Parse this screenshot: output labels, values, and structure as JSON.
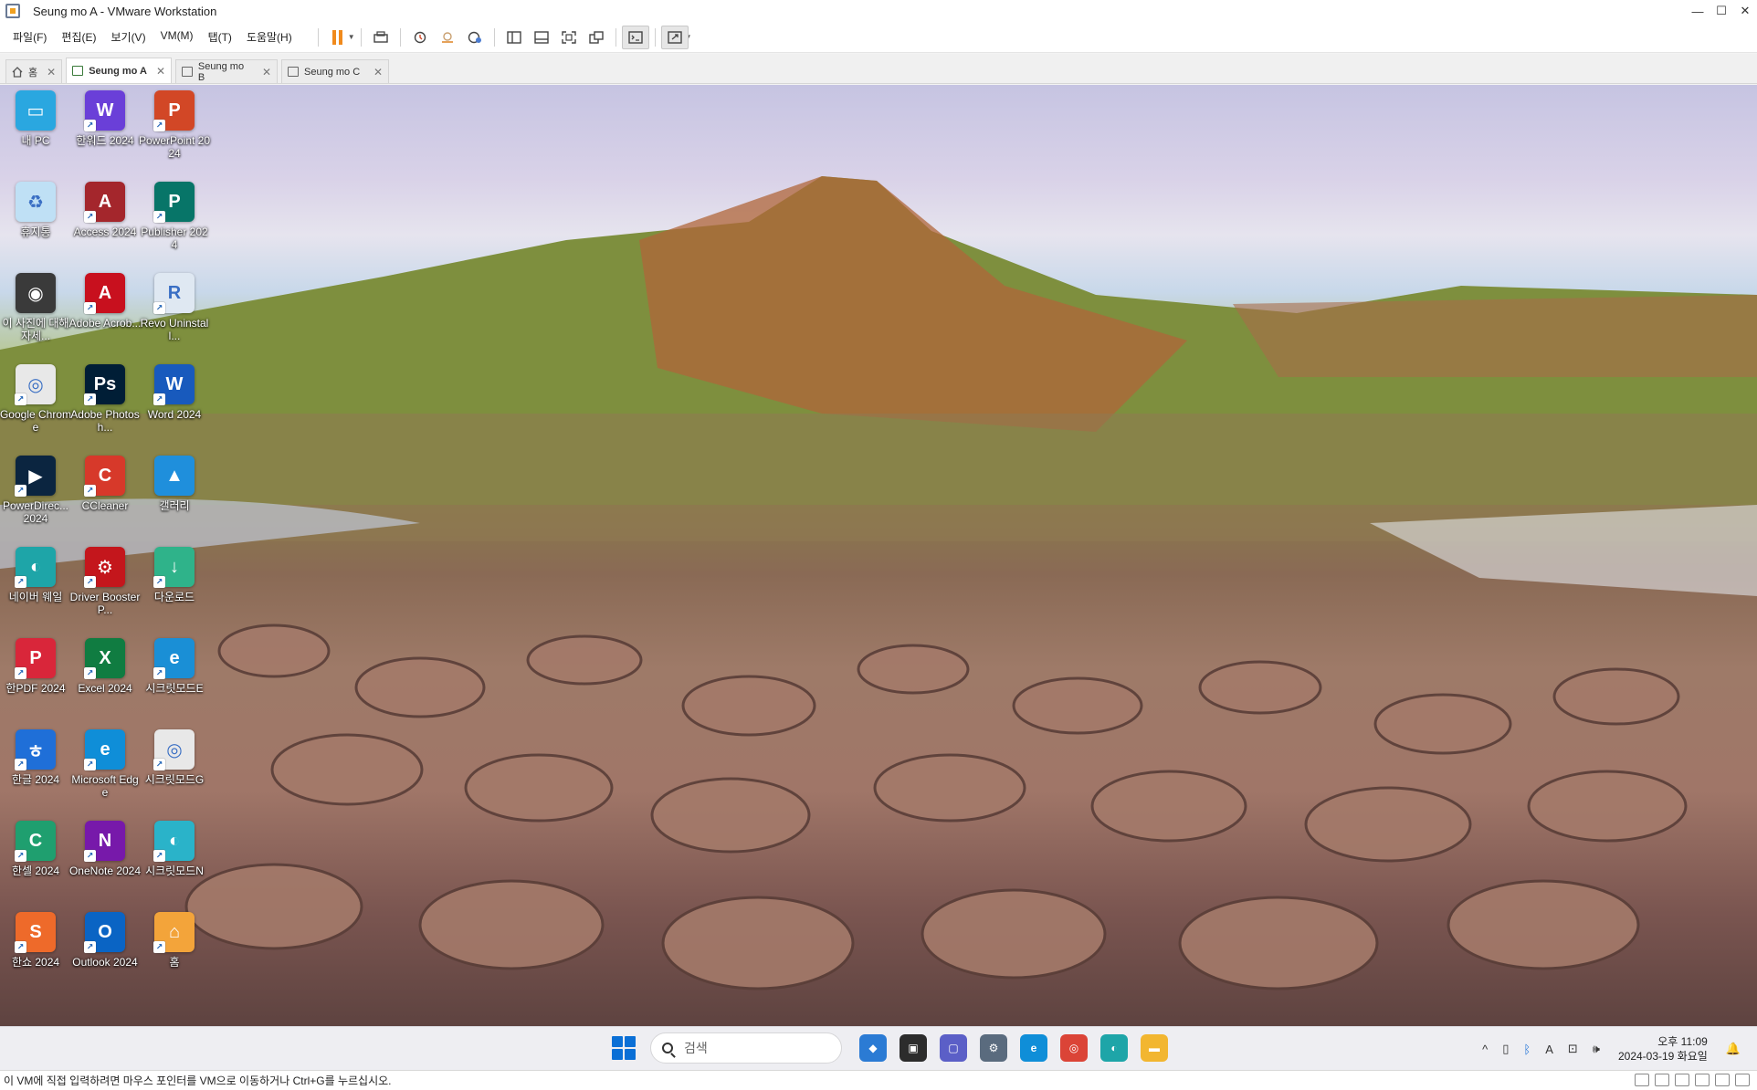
{
  "window": {
    "title": "Seung mo A - VMware Workstation",
    "controls": {
      "minimize": "—",
      "maximize": "☐",
      "close": "✕"
    }
  },
  "menu": [
    "파일(F)",
    "편집(E)",
    "보기(V)",
    "VM(M)",
    "탭(T)",
    "도움말(H)"
  ],
  "tabs": [
    {
      "label": "홈",
      "icon": "home-icon",
      "active": false
    },
    {
      "label": "Seung mo A",
      "icon": "vm-running-icon",
      "active": true
    },
    {
      "label": "Seung mo B",
      "icon": "vm-icon",
      "active": false
    },
    {
      "label": "Seung mo C",
      "icon": "vm-icon",
      "active": false
    }
  ],
  "desktop_icons": [
    {
      "label": "내 PC",
      "icon": "monitor-icon",
      "color": "#2aa7e0",
      "glyph": "▭",
      "shortcut": false
    },
    {
      "label": "한워드 2024",
      "icon": "hanword-icon",
      "color": "#6a3fd8",
      "glyph": "W",
      "shortcut": true
    },
    {
      "label": "PowerPoint 2024",
      "icon": "powerpoint-icon",
      "color": "#d24726",
      "glyph": "P",
      "shortcut": true
    },
    {
      "label": "휴지통",
      "icon": "recycle-bin-icon",
      "color": "#bfe0f5",
      "glyph": "♻",
      "shortcut": false
    },
    {
      "label": "Access 2024",
      "icon": "access-icon",
      "color": "#a4262c",
      "glyph": "A",
      "shortcut": true
    },
    {
      "label": "Publisher 2024",
      "icon": "publisher-icon",
      "color": "#077568",
      "glyph": "P",
      "shortcut": true
    },
    {
      "label": "이 사진에 대해 자세...",
      "icon": "photo-info-icon",
      "color": "#3a3a3a",
      "glyph": "◉",
      "shortcut": false
    },
    {
      "label": "Adobe Acrob...",
      "icon": "acrobat-icon",
      "color": "#c8101e",
      "glyph": "A",
      "shortcut": true
    },
    {
      "label": "Revo Uninstall...",
      "icon": "revo-uninstaller-icon",
      "color": "#dfe8f2",
      "glyph": "R",
      "shortcut": true
    },
    {
      "label": "Google Chrome",
      "icon": "chrome-icon",
      "color": "#e8e8e8",
      "glyph": "◎",
      "shortcut": true
    },
    {
      "label": "Adobe Photosh...",
      "icon": "photoshop-icon",
      "color": "#001e36",
      "glyph": "Ps",
      "shortcut": true
    },
    {
      "label": "Word 2024",
      "icon": "word-icon",
      "color": "#185abd",
      "glyph": "W",
      "shortcut": true
    },
    {
      "label": "PowerDirec... 2024",
      "icon": "powerdirector-icon",
      "color": "#0b2540",
      "glyph": "▶",
      "shortcut": true
    },
    {
      "label": "CCleaner",
      "icon": "ccleaner-icon",
      "color": "#d7392a",
      "glyph": "C",
      "shortcut": true
    },
    {
      "label": "갤러리",
      "icon": "gallery-icon",
      "color": "#1f8fdc",
      "glyph": "▲",
      "shortcut": false
    },
    {
      "label": "네이버 웨일",
      "icon": "whale-icon",
      "color": "#1ea5a8",
      "glyph": "◐",
      "shortcut": true
    },
    {
      "label": "Driver Booster P...",
      "icon": "driver-booster-icon",
      "color": "#c4161c",
      "glyph": "⚙",
      "shortcut": true
    },
    {
      "label": "다운로드",
      "icon": "downloads-folder-icon",
      "color": "#2fb38a",
      "glyph": "↓",
      "shortcut": true
    },
    {
      "label": "한PDF 2024",
      "icon": "hanpdf-icon",
      "color": "#d9263a",
      "glyph": "P",
      "shortcut": true
    },
    {
      "label": "Excel 2024",
      "icon": "excel-icon",
      "color": "#107c41",
      "glyph": "X",
      "shortcut": true
    },
    {
      "label": "시크릿모드E",
      "icon": "edge-icon",
      "color": "#1a8fd6",
      "glyph": "e",
      "shortcut": true
    },
    {
      "label": "한글 2024",
      "icon": "hangul-icon",
      "color": "#1f6fd8",
      "glyph": "ㅎ",
      "shortcut": true
    },
    {
      "label": "Microsoft Edge",
      "icon": "edge-icon",
      "color": "#0f8ed8",
      "glyph": "e",
      "shortcut": true
    },
    {
      "label": "시크릿모드G",
      "icon": "chrome-icon",
      "color": "#e8e8e8",
      "glyph": "◎",
      "shortcut": true
    },
    {
      "label": "한셀 2024",
      "icon": "hancell-icon",
      "color": "#1f9f6f",
      "glyph": "C",
      "shortcut": true
    },
    {
      "label": "OneNote 2024",
      "icon": "onenote-icon",
      "color": "#7719aa",
      "glyph": "N",
      "shortcut": true
    },
    {
      "label": "시크릿모드N",
      "icon": "whale-icon",
      "color": "#2ab3c9",
      "glyph": "◐",
      "shortcut": true
    },
    {
      "label": "한쇼 2024",
      "icon": "hanshow-icon",
      "color": "#ee6a2a",
      "glyph": "S",
      "shortcut": true
    },
    {
      "label": "Outlook 2024",
      "icon": "outlook-icon",
      "color": "#0a64c4",
      "glyph": "O",
      "shortcut": true
    },
    {
      "label": "홈",
      "icon": "home-folder-icon",
      "color": "#f3a43a",
      "glyph": "⌂",
      "shortcut": true
    }
  ],
  "taskbar": {
    "search_placeholder": "검색",
    "apps": [
      {
        "name": "copilot-icon",
        "color": "#2b7bd4",
        "glyph": "◆"
      },
      {
        "name": "task-view-icon",
        "color": "#2c2c2c",
        "glyph": "▣"
      },
      {
        "name": "teams-chat-icon",
        "color": "#5b5fc7",
        "glyph": "▢"
      },
      {
        "name": "settings-icon",
        "color": "#5a6b7e",
        "glyph": "⚙"
      },
      {
        "name": "edge-icon",
        "color": "#0f8ed8",
        "glyph": "e"
      },
      {
        "name": "chrome-icon",
        "color": "#db4437",
        "glyph": "◎"
      },
      {
        "name": "whale-icon",
        "color": "#1ea5a8",
        "glyph": "◐"
      },
      {
        "name": "file-explorer-icon",
        "color": "#f2b630",
        "glyph": "▬"
      }
    ],
    "tray": [
      "^",
      "▯",
      "ᛒ",
      "A",
      "⊡",
      "🕪"
    ],
    "time": "오후 11:09",
    "date": "2024-03-19 화요일",
    "notification": "🔔"
  },
  "status_text": "이 VM에 직접 입력하려면 마우스 포인터를 VM으로 이동하거나 Ctrl+G를 누르십시오."
}
